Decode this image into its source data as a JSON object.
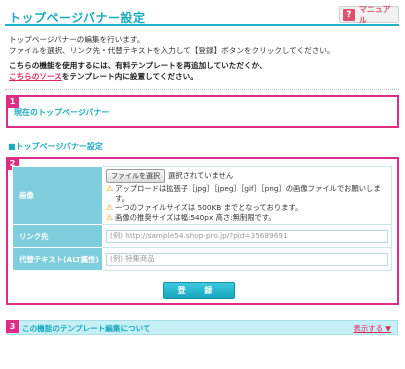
{
  "header": {
    "title": "トップページバナー設定",
    "manual_icon": "?",
    "manual_label": "マニュアル"
  },
  "intro": {
    "line1": "トップページバナーの編集を行います。",
    "line2": "ファイルを選択、リンク先・代替テキストを入力して【登録】ボタンをクリックしてください。"
  },
  "notice": {
    "line1": "こちらの機能を使用するには、有料テンプレートを再追加していただくか、",
    "link": "こちらのソース",
    "line2_rest": "をテンプレート内に設置してください。"
  },
  "section1": {
    "number": "1",
    "label": "現在のトップページバナー"
  },
  "section2": {
    "number": "2",
    "heading": "■トップページバナー設定",
    "image_label": "画像",
    "file_button": "ファイルを選択",
    "file_status": "選択されていません",
    "notes": [
      "アップロードは拡張子［jpg］［jpeg］［gif］［png］の画像ファイルでお願いします。",
      "一つのファイルサイズは 500KB までとなっております。",
      "画像の推奨サイズは幅:540px 高さ:無制限です。"
    ],
    "link_label": "リンク先",
    "link_placeholder": "(例) http://sample54.shop-pro.jp/?pid=35689691",
    "alt_label": "代替テキスト(ALT属性)",
    "alt_placeholder": "(例) 特集商品",
    "submit_label": "登 録"
  },
  "section3": {
    "number": "3",
    "label": "この機能のテンプレート編集について",
    "toggle": "表示する ▼"
  },
  "colors": {
    "accent": "#1ba9bf",
    "highlight": "#de2d86",
    "link": "#e1285a"
  }
}
